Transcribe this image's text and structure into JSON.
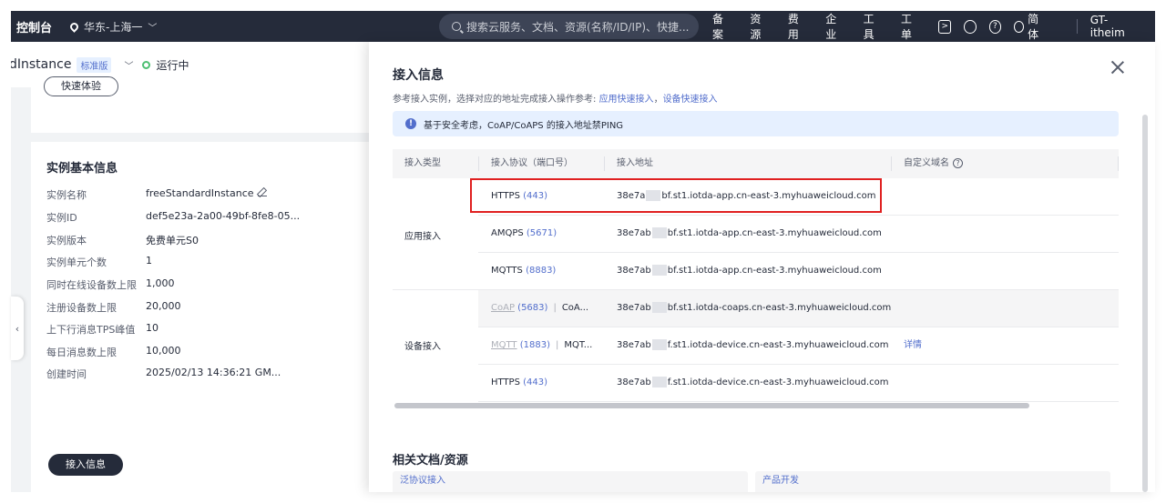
{
  "topbar": {
    "brand": "控制台",
    "region": "华东-上海一",
    "search_placeholder": "搜索云服务、文档、资源(名称/ID/IP)、快捷...",
    "nav": [
      "备案",
      "资源",
      "费用",
      "企业",
      "工具",
      "工单"
    ],
    "language": "简体",
    "user": "GT-itheim"
  },
  "instance": {
    "name": "dInstance",
    "edition": "标准版",
    "status": "运行中",
    "quick_btn": "快速体验"
  },
  "basic_info": {
    "title": "实例基本信息",
    "rows": [
      {
        "k": "实例名称",
        "v": "freeStandardInstance"
      },
      {
        "k": "实例ID",
        "v": "def5e23a-2a00-49bf-8fe8-05..."
      },
      {
        "k": "实例版本",
        "v": "免费单元S0"
      },
      {
        "k": "实例单元个数",
        "v": "1"
      },
      {
        "k": "同时在线设备数上限",
        "v": "1,000"
      },
      {
        "k": "注册设备数上限",
        "v": "20,000"
      },
      {
        "k": "上下行消息TPS峰值",
        "v": "10"
      },
      {
        "k": "每日消息数上限",
        "v": "10,000"
      },
      {
        "k": "创建时间",
        "v": "2025/02/13 14:36:21 GM..."
      }
    ],
    "access_btn": "接入信息"
  },
  "drawer": {
    "title": "接入信息",
    "subtitle": "参考接入实例，选择对应的地址完成接入操作参考: ",
    "link1": "应用快速接入",
    "sep": "，",
    "link2": "设备快速接入",
    "notice": "基于安全考虑，CoAP/CoAPS 的接入地址禁PING",
    "headers": {
      "type": "接入类型",
      "protocol": "接入协议（端口号）",
      "address": "接入地址",
      "domain": "自定义域名"
    },
    "groups": {
      "app": "应用接入",
      "device": "设备接入"
    },
    "rows": [
      {
        "proto": "HTTPS",
        "port": "(443)",
        "pre": "38e7a",
        "post": "bf.st1.iotda-app.cn-east-3.myhuaweicloud.com"
      },
      {
        "proto": "AMQPS",
        "port": "(5671)",
        "pre": "38e7ab",
        "post": "bf.st1.iotda-app.cn-east-3.myhuaweicloud.com"
      },
      {
        "proto": "MQTTS",
        "port": "(8883)",
        "pre": "38e7ab",
        "post": "bf.st1.iotda-app.cn-east-3.myhuaweicloud.com"
      },
      {
        "proto": "CoAP",
        "port": "(5683)",
        "extra": "CoA...",
        "pre": "38e7ab",
        "post": "bf.st1.iotda-coaps.cn-east-3.myhuaweicloud.com"
      },
      {
        "proto": "MQTT",
        "port": "(1883)",
        "extra": "MQT...",
        "pre": "38e7ab",
        "post": "f.st1.iotda-device.cn-east-3.myhuaweicloud.com",
        "domain": "详情"
      },
      {
        "proto": "HTTPS",
        "port": "(443)",
        "pre": "38e7ab",
        "post": "f.st1.iotda-device.cn-east-3.myhuaweicloud.com"
      }
    ],
    "related_title": "相关文档/资源",
    "related": [
      "泛协议接入",
      "产品开发"
    ]
  }
}
